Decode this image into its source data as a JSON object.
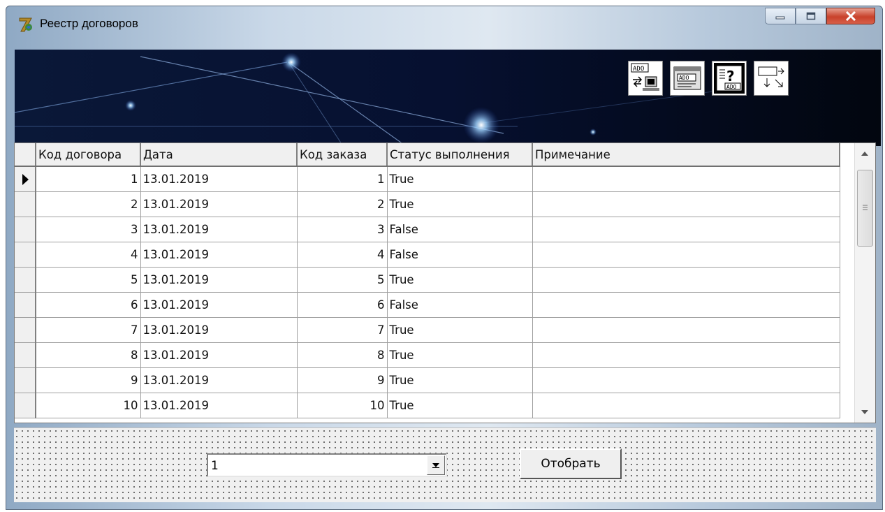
{
  "window": {
    "title": "Реестр договоров",
    "controls": [
      "minimize-icon",
      "maximize-icon",
      "close-icon"
    ]
  },
  "toolbar": {
    "icons": [
      "ado-connection-icon",
      "ado-grid-icon",
      "ado-query-icon",
      "data-move-icon"
    ],
    "icon_labels": [
      "ADO",
      "ADO",
      "ADO"
    ]
  },
  "grid": {
    "columns": [
      "Код договора",
      "Дата",
      "Код заказа",
      "Статус выполнения",
      "Примечание"
    ],
    "rows": [
      [
        "1",
        "13.01.2019",
        "1",
        "True",
        ""
      ],
      [
        "2",
        "13.01.2019",
        "2",
        "True",
        ""
      ],
      [
        "3",
        "13.01.2019",
        "3",
        "False",
        ""
      ],
      [
        "4",
        "13.01.2019",
        "4",
        "False",
        ""
      ],
      [
        "5",
        "13.01.2019",
        "5",
        "True",
        ""
      ],
      [
        "6",
        "13.01.2019",
        "6",
        "False",
        ""
      ],
      [
        "7",
        "13.01.2019",
        "7",
        "True",
        ""
      ],
      [
        "8",
        "13.01.2019",
        "8",
        "True",
        ""
      ],
      [
        "9",
        "13.01.2019",
        "9",
        "True",
        ""
      ],
      [
        "10",
        "13.01.2019",
        "10",
        "True",
        ""
      ]
    ],
    "current_row": 0
  },
  "filter": {
    "selected": "1",
    "button_label": "Отобрать"
  },
  "colors": {
    "banner": "#030a1e",
    "grid_header": "#f0f0f0",
    "close_button": "#c8412b"
  }
}
